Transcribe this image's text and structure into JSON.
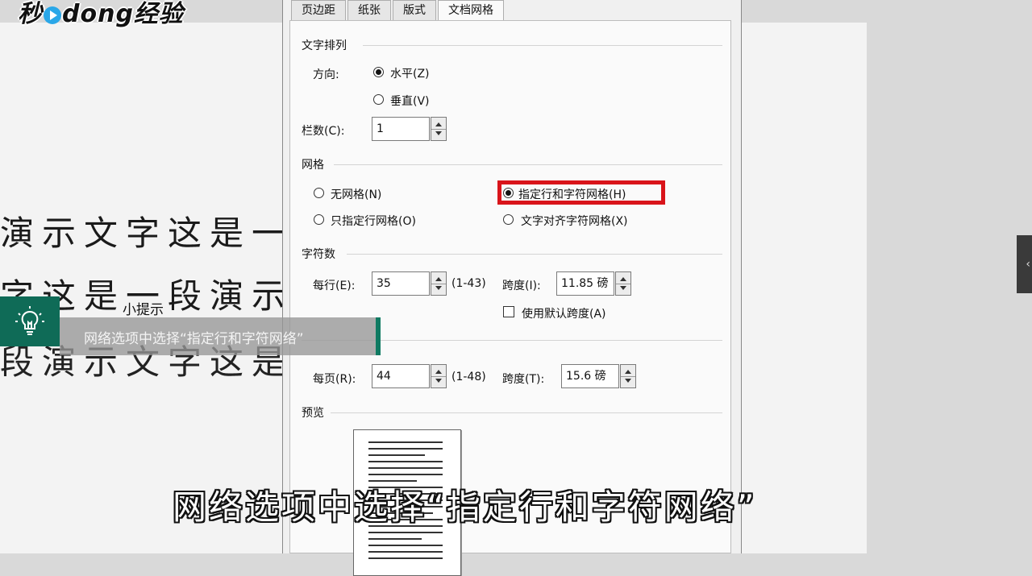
{
  "watermark": {
    "logo_a": "秒",
    "logo_b": "dong经验"
  },
  "document": {
    "lines": [
      "演示文字这是一",
      "字这是一段演示",
      "段演示文字这是"
    ]
  },
  "dialog": {
    "tabs": [
      "页边距",
      "纸张",
      "版式",
      "文档网格"
    ],
    "text_direction": {
      "title": "文字排列",
      "direction_label": "方向:",
      "horizontal": "水平(Z)",
      "vertical": "垂直(V)",
      "columns_label": "栏数(C):",
      "columns_value": "1"
    },
    "grid": {
      "title": "网格",
      "none": "无网格(N)",
      "lines_only": "只指定行网格(O)",
      "lines_and_chars": "指定行和字符网格(H)",
      "snap_chars": "文字对齐字符网格(X)"
    },
    "characters": {
      "title": "字符数",
      "per_line_label": "每行(E):",
      "per_line_value": "35",
      "per_line_range": "(1-43)",
      "pitch_label": "跨度(I):",
      "pitch_value": "11.85 磅",
      "default_pitch": "使用默认跨度(A)"
    },
    "lines": {
      "per_page_label": "每页(R):",
      "per_page_value": "44",
      "per_page_range": "(1-48)",
      "pitch_label": "跨度(T):",
      "pitch_value": "15.6 磅"
    },
    "preview": {
      "title": "预览"
    }
  },
  "tip": {
    "title": "小提示",
    "text": "网络选项中选择“指定行和字符网络”"
  },
  "subtitle": "网络选项中选择“指定行和字符网络”",
  "colors": {
    "highlight": "#d9141a",
    "tip_green": "#0f6b57"
  }
}
